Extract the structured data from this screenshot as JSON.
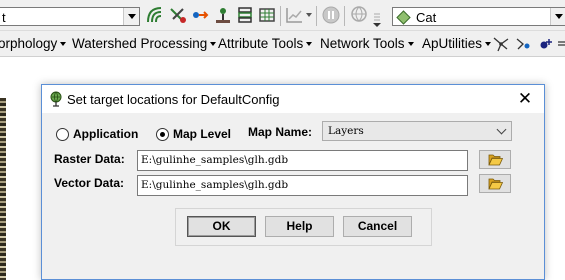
{
  "toolbar": {
    "left_combo_text": "t",
    "feature_combo_text": "Cat"
  },
  "menubar": {
    "items": [
      {
        "label": "orphology"
      },
      {
        "label": "Watershed Processing"
      },
      {
        "label": "Attribute Tools"
      },
      {
        "label": "Network Tools"
      },
      {
        "label": "ApUtilities"
      }
    ]
  },
  "dialog": {
    "title": "Set target locations for DefaultConfig",
    "close_glyph": "✕",
    "radio_application": "Application",
    "radio_map_level": "Map Level",
    "selected_radio": "Map Level",
    "map_name_label": "Map Name:",
    "map_name_value": "Layers",
    "raster_label": "Raster Data:",
    "raster_path": "E:\\gulinhe_samples\\glh.gdb",
    "vector_label": "Vector Data:",
    "vector_path": "E:\\gulinhe_samples\\glh.gdb",
    "ok_label": "OK",
    "help_label": "Help",
    "cancel_label": "Cancel"
  },
  "colors": {
    "dialog_border": "#5b8fd6",
    "folder_icon": "#e8b838",
    "toolbar_bg": "#f0f0f0"
  }
}
